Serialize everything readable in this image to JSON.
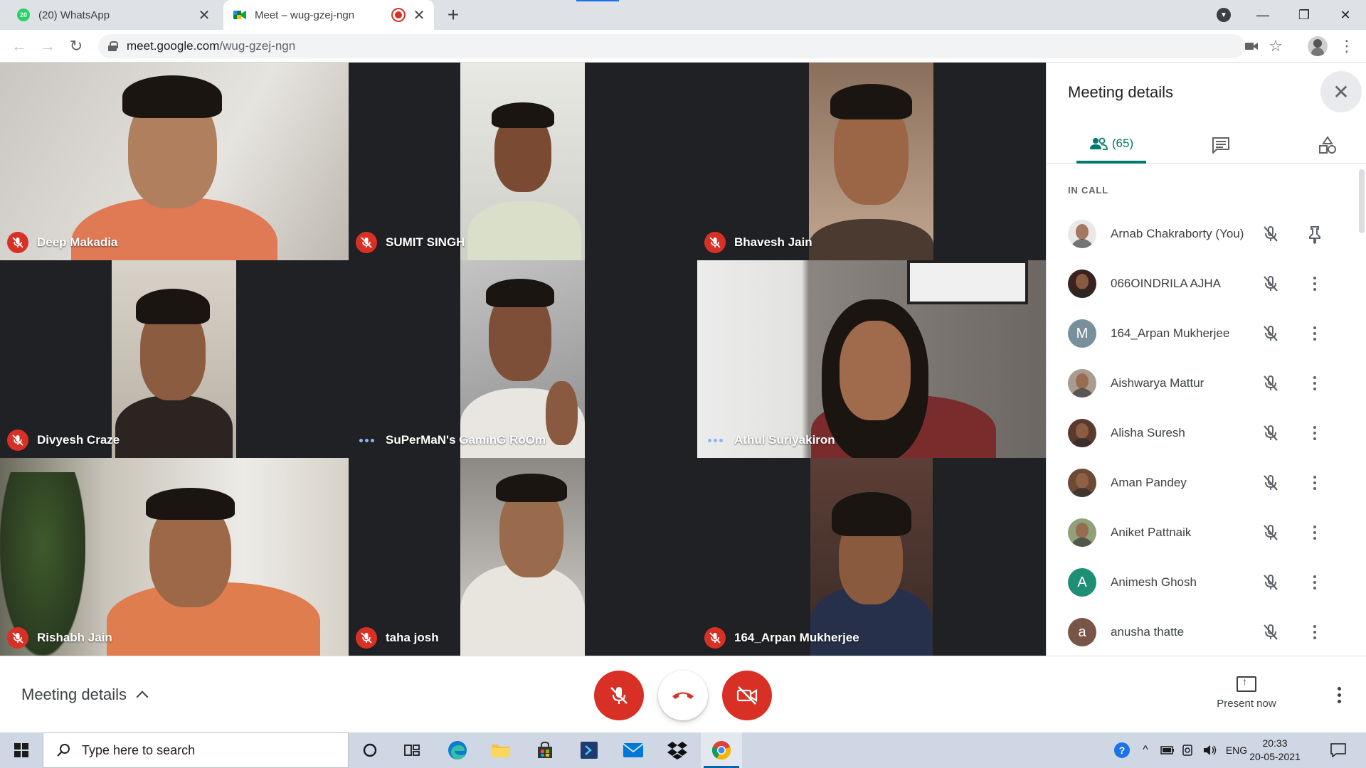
{
  "browser": {
    "tabs": [
      {
        "title": "(20) WhatsApp",
        "badge": "20",
        "active": false
      },
      {
        "title": "Meet – wug-gzej-ngn",
        "active": true,
        "recording": true
      }
    ],
    "url_host": "meet.google.com",
    "url_path": "/wug-gzej-ngn"
  },
  "tiles": [
    {
      "name": "Deep Makadia",
      "status": "muted"
    },
    {
      "name": "SUMIT SINGH",
      "status": "muted"
    },
    {
      "name": "Bhavesh Jain",
      "status": "muted"
    },
    {
      "name": "Divyesh Craze",
      "status": "muted"
    },
    {
      "name": "SuPerMaN's GaminG RoOm",
      "status": "speaking"
    },
    {
      "name": "Athul Suriyakiron",
      "status": "speaking"
    },
    {
      "name": "Rishabh Jain",
      "status": "muted"
    },
    {
      "name": "taha josh",
      "status": "muted"
    },
    {
      "name": "164_Arpan Mukherjee",
      "status": "muted"
    }
  ],
  "panel": {
    "title": "Meeting details",
    "people_count": "(65)",
    "section_label": "IN CALL",
    "participants": [
      {
        "name": "Arnab Chakraborty (You)",
        "avatar": "photo",
        "color": "#e8e8e8",
        "action": "pin"
      },
      {
        "name": "066OINDRILA AJHA",
        "avatar": "photo",
        "color": "#3a2220",
        "action": "more"
      },
      {
        "name": "164_Arpan Mukherjee",
        "avatar": "M",
        "color": "#78909c",
        "action": "more"
      },
      {
        "name": "Aishwarya Mattur",
        "avatar": "photo",
        "color": "#a89c90",
        "action": "more"
      },
      {
        "name": "Alisha Suresh",
        "avatar": "photo",
        "color": "#5a3a30",
        "action": "more"
      },
      {
        "name": "Aman Pandey",
        "avatar": "photo",
        "color": "#6b4a36",
        "action": "more"
      },
      {
        "name": "Aniket Pattnaik",
        "avatar": "photo",
        "color": "#8fa07a",
        "action": "more"
      },
      {
        "name": "Animesh Ghosh",
        "avatar": "A",
        "color": "#1e8e74",
        "action": "more"
      },
      {
        "name": "anusha thatte",
        "avatar": "a",
        "color": "#795548",
        "action": "more"
      }
    ]
  },
  "controls": {
    "meeting_details_label": "Meeting details",
    "present_now_label": "Present now"
  },
  "taskbar": {
    "search_placeholder": "Type here to search",
    "language": "ENG",
    "time": "20:33",
    "date": "20-05-2021"
  },
  "colors": {
    "meet_red": "#d93025",
    "meet_teal": "#00796b",
    "grid_bg": "#202124"
  }
}
